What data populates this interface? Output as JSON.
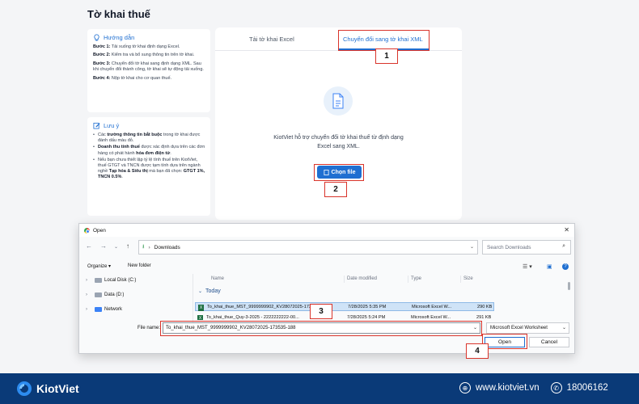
{
  "page": {
    "title": "Tờ khai thuế"
  },
  "guide": {
    "heading": "Hướng dẫn",
    "steps": [
      {
        "label": "Bước 1:",
        "text": "Tải xuống tờ khai định dạng Excel."
      },
      {
        "label": "Bước 2:",
        "text": "Kiểm tra và bổ sung thông tin trên tờ khai."
      },
      {
        "label": "Bước 3:",
        "text": "Chuyển đổi tờ khai sang định dạng XML. Sau khi chuyển đổi thành công, tờ khai sẽ tự động tải xuống."
      },
      {
        "label": "Bước 4:",
        "text": "Nộp tờ khai cho cơ quan thuế."
      }
    ]
  },
  "notes": {
    "heading": "Lưu ý",
    "items": [
      {
        "pre": "Các ",
        "bold": "trường thông tin bắt buộc",
        "post": " trong tờ khai được đánh dấu màu đỏ."
      },
      {
        "pre": "",
        "bold": "Doanh thu tính thuế",
        "post": " được xác định dựa trên các đơn hàng có phát hành ",
        "bold2": "hóa đơn điện tử",
        "post2": "."
      },
      {
        "pre": "Nếu bạn chưa thiết lập tỷ lệ tính thuế trên KiotViet, thuế GTGT và TNCN được tạm tính dựa trên ngành nghề ",
        "bold": "Tạp hóa & Siêu thị",
        "post": " mà bạn đã chọn: ",
        "bold2": "GTGT 1%, TNCN 0.5%",
        "post2": "."
      }
    ]
  },
  "main": {
    "tabs": [
      {
        "label": "Tải tờ khai Excel"
      },
      {
        "label": "Chuyển đổi sang tờ khai XML"
      }
    ],
    "description_line1": "KiotViet hỗ trợ chuyển đổi tờ khai thuế từ định dạng",
    "description_line2": "Excel sang XML.",
    "choose_file": "Chọn file"
  },
  "callouts": [
    "1",
    "2",
    "3",
    "4"
  ],
  "dialog": {
    "title": "Open",
    "address": "Downloads",
    "search_placeholder": "Search Downloads",
    "organize": "Organize ▾",
    "new_folder": "New folder",
    "nav": [
      {
        "label": "Local Disk (C:)"
      },
      {
        "label": "Data (D:)"
      },
      {
        "label": "Network"
      }
    ],
    "columns": {
      "name": "Name",
      "date": "Date modified",
      "type": "Type",
      "size": "Size"
    },
    "group": "Today",
    "files": [
      {
        "name": "To_khai_thue_MST_9999999902_KV28072025-173535-188",
        "date": "7/28/2025 5:35 PM",
        "type": "Microsoft Excel W...",
        "size": "290 KB"
      },
      {
        "name": "To_khai_thue_Quy-3-2025 - 2222222222-00...",
        "date": "7/28/2025 5:24 PM",
        "type": "Microsoft Excel W...",
        "size": "291 KB"
      }
    ],
    "file_name_label": "File name:",
    "file_name_value": "To_khai_thue_MST_9999999902_KV28072025-173535-188",
    "file_type": "Microsoft Excel Worksheet",
    "open_label": "Open",
    "cancel_label": "Cancel"
  },
  "footer": {
    "brand": "KiotViet",
    "website": "www.kiotviet.vn",
    "phone": "18006162",
    "brand_color": "#0a3a78"
  }
}
